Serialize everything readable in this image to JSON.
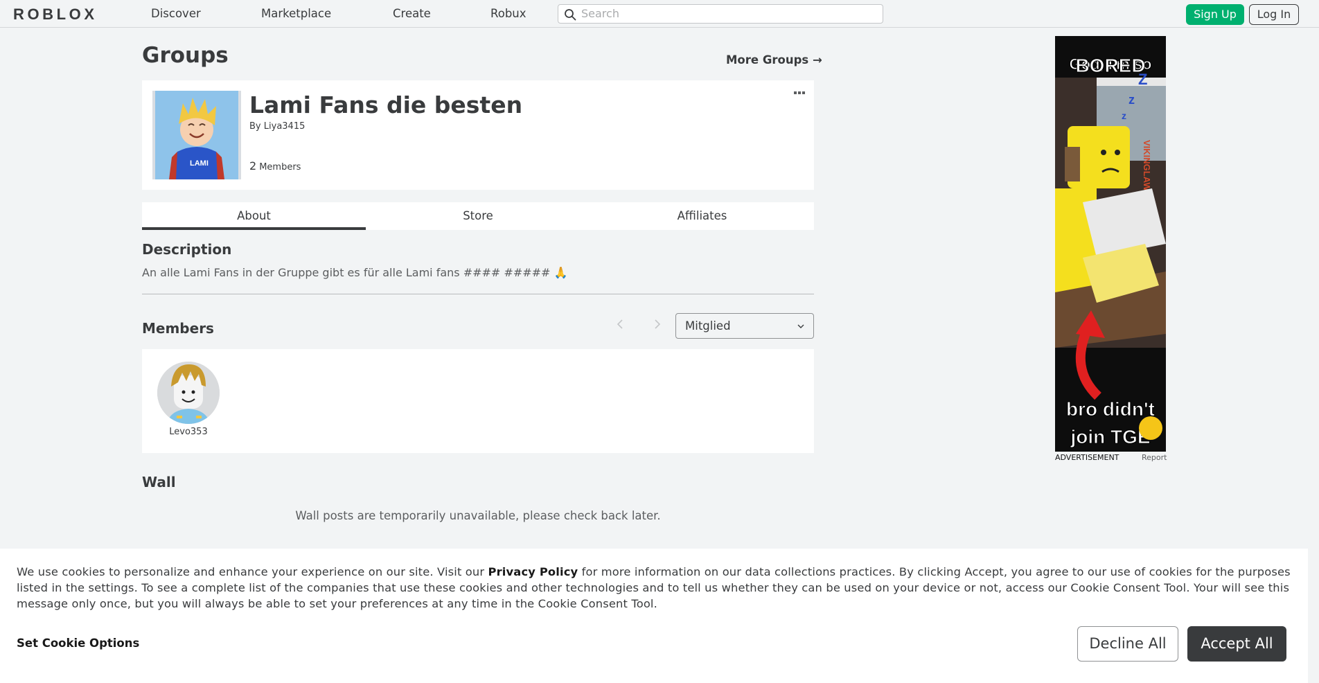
{
  "header": {
    "logo_text": "ROBLOX",
    "nav": [
      "Discover",
      "Marketplace",
      "Create",
      "Robux"
    ],
    "search_placeholder": "Search",
    "signup_label": "Sign Up",
    "login_label": "Log In"
  },
  "page": {
    "title": "Groups",
    "more_groups": "More Groups →"
  },
  "group": {
    "name": "Lami Fans die besten",
    "by_label": "By",
    "owner": "Liya3415",
    "member_count": "2",
    "member_label": "Members",
    "emblem_text": "LAMI"
  },
  "tabs": [
    "About",
    "Store",
    "Affiliates"
  ],
  "about": {
    "description_title": "Description",
    "description": "An alle Lami Fans in der Gruppe gibt es für alle Lami fans #### ##### 🙏",
    "members_title": "Members",
    "role_selected": "Mitglied",
    "members": [
      {
        "name": "Levo353"
      }
    ],
    "wall_title": "Wall",
    "wall_message": "Wall posts are temporarily unavailable, please check back later."
  },
  "ad": {
    "top_line1": "God, I'm so",
    "top_line2": "BORED",
    "bottom_line1": "bro didn't",
    "bottom_line2": "join TGE",
    "side_text": "VIKINGLAW",
    "label": "ADVERTISEMENT",
    "report": "Report"
  },
  "cookie": {
    "text_before": "We use cookies to personalize and enhance your experience on our site. Visit our ",
    "privacy_link": "Privacy Policy",
    "text_after": " for more information on our data collections practices. By clicking Accept, you agree to our use of cookies for the purposes listed in the settings. To see a complete list of the companies that use these cookies and other technologies and to tell us whether they can be used on your device or not, access our Cookie Consent Tool. Your will see this message only once, but you will always be able to set your preferences at any time in the Cookie Consent Tool.",
    "options_label": "Set Cookie Options",
    "decline_label": "Decline All",
    "accept_label": "Accept All"
  },
  "colors": {
    "brand_green": "#00b06f",
    "text_dark": "#393b3d",
    "page_bg": "#f2f4f5"
  }
}
